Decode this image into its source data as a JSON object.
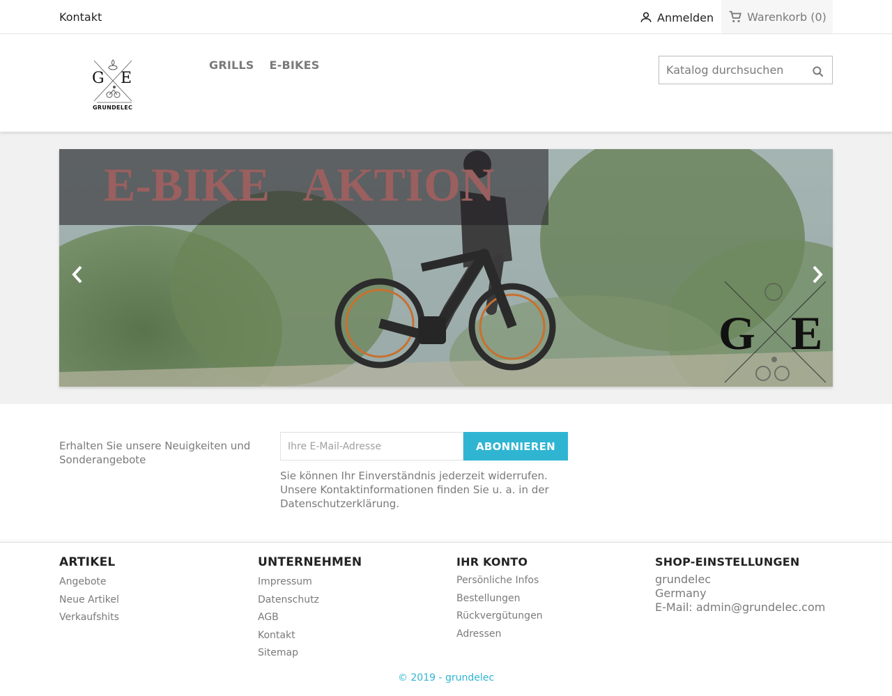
{
  "topnav": {
    "contact": "Kontakt",
    "signin": "Anmelden",
    "cart": "Warenkorb (0)",
    "icons": {
      "signin": "user-icon",
      "cart": "shopping-cart-icon"
    }
  },
  "header": {
    "logo": {
      "letter_left": "G",
      "letter_right": "E",
      "brand": "GRUNDELEC"
    },
    "menu": [
      {
        "label": "GRILLS"
      },
      {
        "label": "E-BIKES"
      }
    ],
    "search": {
      "placeholder": "Katalog durchsuchen",
      "icon": "search-icon"
    }
  },
  "slider": {
    "banner_text": "E-BIKE   AKTION",
    "watermark_left": "G",
    "watermark_right": "E",
    "icons": {
      "prev": "chevron-left-icon",
      "next": "chevron-right-icon"
    }
  },
  "newsletter": {
    "label": "Erhalten Sie unsere Neuigkeiten und Sonderangebote",
    "input_placeholder": "Ihre E-Mail-Adresse",
    "button": "ABONNIEREN",
    "note": "Sie können Ihr Einverständnis jederzeit widerrufen. Unsere Kontaktinformationen finden Sie u. a. in der Datenschutzerklärung."
  },
  "footer": {
    "artikel": {
      "title": "ARTIKEL",
      "links": [
        "Angebote",
        "Neue Artikel",
        "Verkaufshits"
      ]
    },
    "unternehmen": {
      "title": "UNTERNEHMEN",
      "links": [
        "Impressum",
        "Datenschutz",
        "AGB",
        "Kontakt",
        "Sitemap"
      ]
    },
    "konto": {
      "title": "IHR KONTO",
      "links": [
        "Persönliche Infos",
        "Bestellungen",
        "Rückvergütungen",
        "Adressen"
      ]
    },
    "shop": {
      "title": "SHOP-EINSTELLUNGEN",
      "name": "grundelec",
      "country": "Germany",
      "email": "E-Mail: admin@grundelec.com"
    },
    "copyright": "© 2019 - grundelec"
  },
  "colors": {
    "accent": "#2fb5d2",
    "muted_text": "#7a7a7a",
    "dark_text": "#232323"
  }
}
